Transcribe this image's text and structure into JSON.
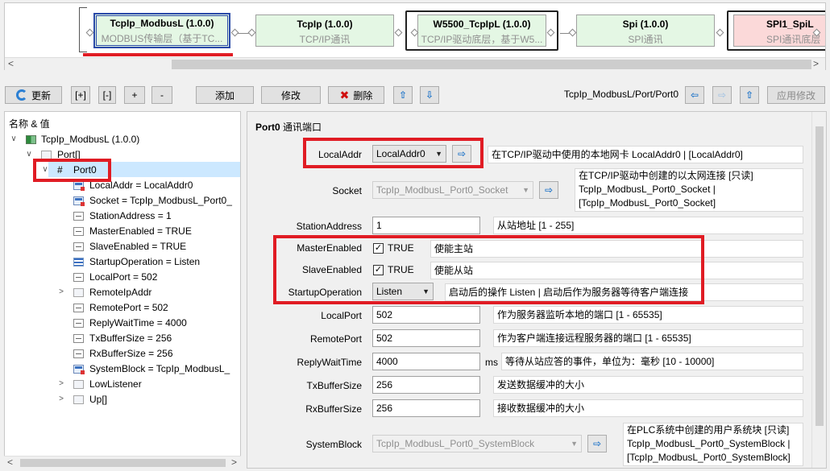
{
  "chain": {
    "nodes": [
      {
        "title": "TcpIp_ModbusL (1.0.0)",
        "subtitle": "MODBUS传输层（基于TC..."
      },
      {
        "title": "TcpIp (1.0.0)",
        "subtitle": "TCP/IP通讯"
      },
      {
        "title": "W5500_TcpIpL (1.0.0)",
        "subtitle": "TCP/IP驱动底层，基于W5..."
      },
      {
        "title": "Spi (1.0.0)",
        "subtitle": "SPI通讯"
      },
      {
        "title": "SPI1_SpiL",
        "subtitle": "SPI通讯底层"
      }
    ],
    "scroll_left": "<",
    "scroll_right": ">"
  },
  "toolbar": {
    "refresh": "更新",
    "expand_all": "[+]",
    "collapse_all": "[-]",
    "expand": "+",
    "collapse": "-",
    "add": "添加",
    "modify": "修改",
    "delete": "删除",
    "up_arrow": "⇧",
    "down_arrow": "⇩",
    "path": "TcpIp_ModbusL/Port/Port0",
    "back_arrow": "⇦",
    "forward_arrow": "⇨",
    "parent_arrow": "⇧",
    "apply": "应用修改"
  },
  "tree": {
    "header": "名称 & 值",
    "items": [
      {
        "label": "TcpIp_ModbusL (1.0.0)",
        "twist": "∨"
      },
      {
        "label": "Port[]",
        "twist": "∨"
      },
      {
        "label": "Port0",
        "twist": "∨",
        "mark": "#"
      },
      {
        "label": "LocalAddr = LocalAddr0"
      },
      {
        "label": "Socket = TcpIp_ModbusL_Port0_"
      },
      {
        "label": "StationAddress = 1"
      },
      {
        "label": "MasterEnabled = TRUE"
      },
      {
        "label": "SlaveEnabled = TRUE"
      },
      {
        "label": "StartupOperation = Listen"
      },
      {
        "label": "LocalPort = 502"
      },
      {
        "label": "RemoteIpAddr",
        "twist": ">"
      },
      {
        "label": "RemotePort = 502"
      },
      {
        "label": "ReplyWaitTime = 4000"
      },
      {
        "label": "TxBufferSize = 256"
      },
      {
        "label": "RxBufferSize = 256"
      },
      {
        "label": "SystemBlock = TcpIp_ModbusL_"
      },
      {
        "label": "LowListener",
        "twist": ">"
      },
      {
        "label": "Up[]",
        "twist": ">"
      }
    ]
  },
  "props": {
    "title_bold": "Port0",
    "title_rest": " 通讯端口",
    "local_addr": {
      "label": "LocalAddr",
      "value": "LocalAddr0",
      "desc": "在TCP/IP驱动中使用的本地网卡 LocalAddr0 | [LocalAddr0]"
    },
    "socket": {
      "label": "Socket",
      "value": "TcpIp_ModbusL_Port0_Socket",
      "desc1": "在TCP/IP驱动中创建的以太网连接 [只读]",
      "desc2": "TcpIp_ModbusL_Port0_Socket |",
      "desc3": "[TcpIp_ModbusL_Port0_Socket]"
    },
    "station_address": {
      "label": "StationAddress",
      "value": "1",
      "desc": "从站地址 [1 - 255]"
    },
    "master_enabled": {
      "label": "MasterEnabled",
      "value": "TRUE",
      "desc": "使能主站"
    },
    "slave_enabled": {
      "label": "SlaveEnabled",
      "value": "TRUE",
      "desc": "使能从站"
    },
    "startup_operation": {
      "label": "StartupOperation",
      "value": "Listen",
      "desc": "启动后的操作 Listen | 启动后作为服务器等待客户端连接"
    },
    "local_port": {
      "label": "LocalPort",
      "value": "502",
      "desc": "作为服务器监听本地的端口 [1 - 65535]"
    },
    "remote_port": {
      "label": "RemotePort",
      "value": "502",
      "desc": "作为客户端连接远程服务器的端口 [1 - 65535]"
    },
    "reply_wait_time": {
      "label": "ReplyWaitTime",
      "value": "4000",
      "unit": "ms",
      "desc": "等待从站应答的事件，单位为：毫秒 [10 - 10000]"
    },
    "tx_buffer_size": {
      "label": "TxBufferSize",
      "value": "256",
      "desc": "发送数据缓冲的大小"
    },
    "rx_buffer_size": {
      "label": "RxBufferSize",
      "value": "256",
      "desc": "接收数据缓冲的大小"
    },
    "system_block": {
      "label": "SystemBlock",
      "value": "TcpIp_ModbusL_Port0_SystemBlock",
      "desc1": "在PLC系统中创建的用户系统块 [只读]",
      "desc2": "TcpIp_ModbusL_Port0_SystemBlock |",
      "desc3": "[TcpIp_ModbusL_Port0_SystemBlock]"
    },
    "go_arrow": "⇨",
    "check_mark": "✓",
    "dropdown": "▼"
  },
  "colors": {
    "highlight": "#e01c24",
    "selection": "#cce8ff",
    "node_fill": "#e4f7e4"
  }
}
